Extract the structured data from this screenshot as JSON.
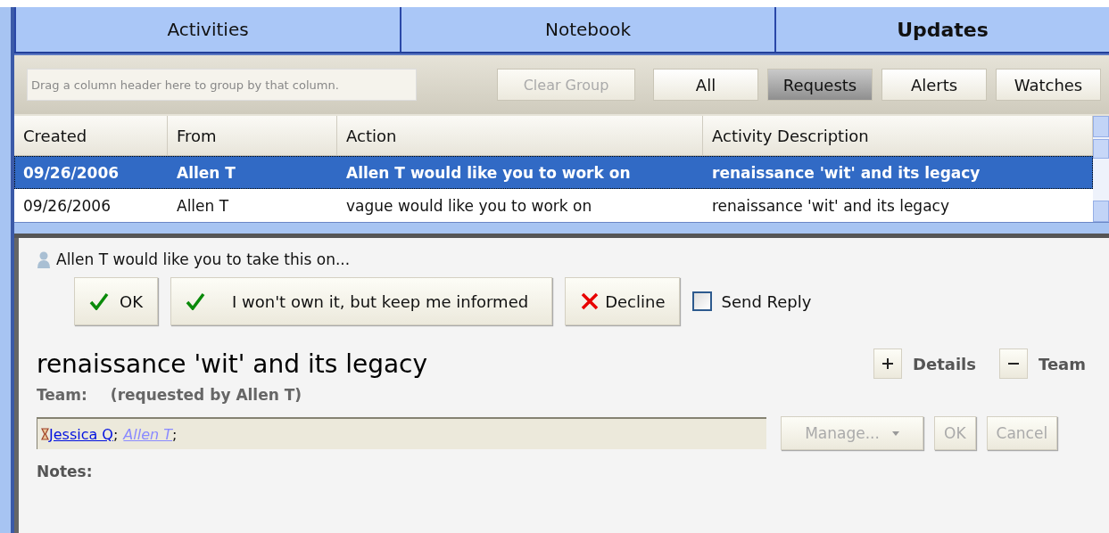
{
  "tabs": [
    {
      "label": "Activities",
      "selected": false
    },
    {
      "label": "Notebook",
      "selected": false
    },
    {
      "label": "Updates",
      "selected": true
    }
  ],
  "toolbar": {
    "group_placeholder": "Drag a column header here to group by that column.",
    "clear_group": {
      "label": "Clear Group",
      "disabled": true
    },
    "filters": [
      {
        "label": "All",
        "selected": false
      },
      {
        "label": "Requests",
        "selected": true
      },
      {
        "label": "Alerts",
        "selected": false
      },
      {
        "label": "Watches",
        "selected": false
      }
    ]
  },
  "table": {
    "columns": [
      "Created",
      "From",
      "Action",
      "Activity Description"
    ],
    "rows": [
      {
        "selected": true,
        "cells": [
          "09/26/2006",
          "Allen T",
          "Allen T would like you to work on",
          "renaissance 'wit' and its legacy"
        ]
      },
      {
        "selected": false,
        "cells": [
          "09/26/2006",
          "Allen T",
          "vague would like you to work on",
          "renaissance 'wit' and its legacy"
        ]
      }
    ]
  },
  "request": {
    "message": "Allen T would like you to take this on...",
    "actions": [
      {
        "kind": "accept",
        "label": "OK"
      },
      {
        "kind": "accept",
        "label": "I won't own it, but keep me informed"
      },
      {
        "kind": "decline",
        "label": "Decline"
      }
    ],
    "send_reply": {
      "label": "Send Reply",
      "checked": false
    }
  },
  "activity": {
    "title": "renaissance 'wit' and its legacy",
    "toggles": [
      {
        "label": "Details",
        "expanded": false
      },
      {
        "label": "Team",
        "expanded": true
      }
    ],
    "team_label": "Team:",
    "team_note": "(requested by Allen T)",
    "members": [
      {
        "name": "Jessica Q",
        "kind": "pending",
        "separator": ";"
      },
      {
        "name": "Allen T",
        "kind": "requester",
        "separator": ";"
      }
    ],
    "team_buttons": [
      {
        "label": "Manage...",
        "kind": "dropdown",
        "disabled": true
      },
      {
        "label": "OK",
        "kind": "plain",
        "disabled": true
      },
      {
        "label": "Cancel",
        "kind": "plain",
        "disabled": true
      }
    ],
    "notes_label": "Notes:"
  }
}
